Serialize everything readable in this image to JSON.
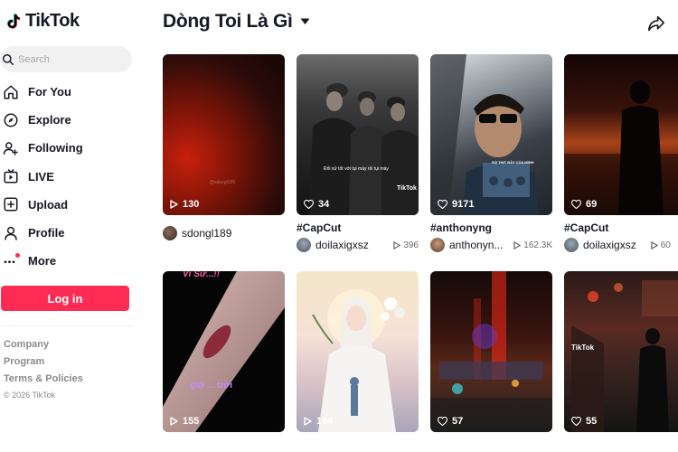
{
  "app": {
    "name": "TikTok"
  },
  "search": {
    "placeholder": "Search"
  },
  "nav": {
    "for_you": "For You",
    "explore": "Explore",
    "following": "Following",
    "live": "LIVE",
    "upload": "Upload",
    "profile": "Profile",
    "more": "More"
  },
  "login_label": "Log in",
  "footer": {
    "company": "Company",
    "program": "Program",
    "terms": "Terms & Policies",
    "copyright": "© 2026 TikTok"
  },
  "page_title": "Dòng Toi Là Gì",
  "videos": [
    {
      "views": "130",
      "author": "sdongl189"
    },
    {
      "views": "34",
      "caption": "#CapCut",
      "author": "doilaxigxsz",
      "plays": "396",
      "overlay": "Đối xử tốt với tụi mày rồi tụi mày"
    },
    {
      "views": "9171",
      "caption": "#anthonyng",
      "author": "anthonyn...",
      "plays": "162.3K",
      "overlay": "SỢ THỊT ĐẦY CỦA MÌNH"
    },
    {
      "views": "69",
      "caption": "#CapCut",
      "author": "doilaxigxsz",
      "plays": "60"
    },
    {
      "views": "155",
      "overlay_top": "Ví Sử...!!",
      "overlay_mid": "giờ ... trời"
    },
    {
      "views": "164"
    },
    {
      "views": "57"
    },
    {
      "views": "55",
      "overlay": "TikTok"
    }
  ],
  "colors": {
    "brand_red": "#fe2c55",
    "text": "#161823",
    "muted": "#8a8b91"
  },
  "icons": [
    "tiktok-logo-icon",
    "search-icon",
    "home-icon",
    "compass-icon",
    "user-plus-icon",
    "live-tv-icon",
    "plus-square-icon",
    "user-icon",
    "more-dots-icon",
    "caret-down-icon",
    "share-icon",
    "play-icon",
    "heart-icon"
  ]
}
